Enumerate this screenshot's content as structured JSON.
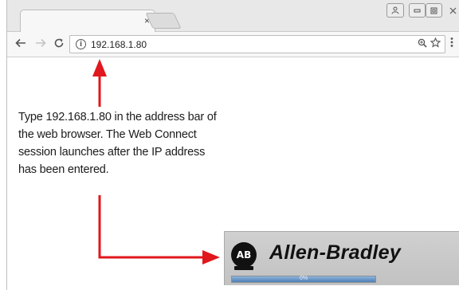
{
  "browser": {
    "tab_close_glyph": "×",
    "url": "192.168.1.80",
    "icons": [
      "back-arrow-icon",
      "forward-arrow-icon",
      "reload-icon",
      "info-icon",
      "zoom-icon",
      "star-icon",
      "menu-icon"
    ]
  },
  "annotation": {
    "instruction": "Type 192.168.1.80 in the address bar of the web browser. The Web Connect session launches after the IP address has been entered.",
    "arrow_color": "#e0171c"
  },
  "splash": {
    "logo_text": "AB",
    "brand": "Allen-Bradley",
    "progress_percent": 100,
    "progress_label": "0%"
  }
}
